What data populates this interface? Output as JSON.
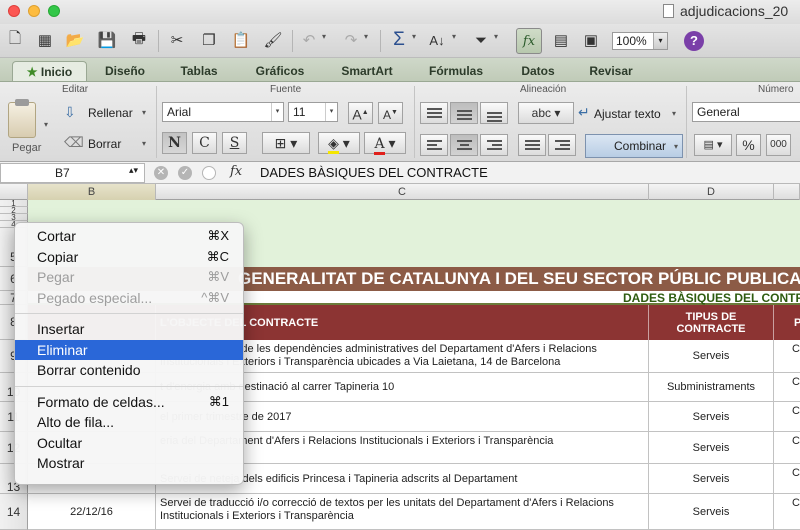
{
  "window": {
    "title": "adjudicacions_20"
  },
  "toolbar": {
    "zoom": "100%"
  },
  "ribbon_tabs": [
    "Inicio",
    "Diseño",
    "Tablas",
    "Gráficos",
    "SmartArt",
    "Fórmulas",
    "Datos",
    "Revisar"
  ],
  "ribbon": {
    "editar": {
      "title": "Editar",
      "pegar": "Pegar",
      "rellenar": "Rellenar",
      "borrar": "Borrar"
    },
    "fuente": {
      "title": "Fuente",
      "font_name": "Arial",
      "font_size": "11",
      "grow": "A",
      "shrink": "A",
      "bold": "N",
      "italic": "C",
      "underline": "S",
      "font_color": "A"
    },
    "alineacion": {
      "title": "Alineación",
      "abc": "abc",
      "ajustar_texto": "Ajustar texto",
      "combinar": "Combinar"
    },
    "numero": {
      "title": "Número",
      "format": "General",
      "percent": "%",
      "thousands": "000"
    }
  },
  "formula_bar": {
    "cell_ref": "B7",
    "fx": "fx",
    "content": "DADES BÀSIQUES DEL CONTRACTE"
  },
  "columns": [
    "B",
    "C",
    "D"
  ],
  "rows": [
    "1",
    "2",
    "3",
    "4",
    "5",
    "6",
    "7",
    "8",
    "9",
    "10",
    "11",
    "12",
    "13",
    "14"
  ],
  "sheet": {
    "banner": "GENERALITAT DE CATALUNYA I DEL SEU SECTOR PÚBLIC PUBLICADES",
    "subbanner": "DADES BÀSIQUES DEL CONTR",
    "header_c": "L'OBJECTE DEL CONTRACTE",
    "header_d": "TIPUS DE CONTRACTE",
    "header_e": "P",
    "table_rows": [
      {
        "date": "",
        "object": "eteja i seguretat de les dependències administratives del Departament d'Afers i Relacions Institucionals i Exteriors i Transparència ubicades a Via Laietana, 14 de Barcelona",
        "type": "Serveis",
        "extra": "Co"
      },
      {
        "date": "",
        "object": "t d'energia amb destinació al carrer Tapineria 10",
        "type": "Subministraments",
        "extra": "Co"
      },
      {
        "date": "",
        "object": "el primer trimestre de 2017",
        "type": "Serveis",
        "extra": "Co"
      },
      {
        "date": "",
        "object": "eria del Departament d'Afers i Relacions Institucionals i Exteriors i Transparència",
        "type": "Serveis",
        "extra": "Co"
      },
      {
        "date": "",
        "object": "Servei de neteja dels edificis Princesa i Tapineria adscrits al Departament",
        "type": "Serveis",
        "extra": "Co"
      },
      {
        "date": "22/12/16",
        "object": "Servei de traducció i/o correcció de textos per les unitats del Departament d'Afers i Relacions Institucionals i Exteriors i Transparència",
        "type": "Serveis",
        "extra": "Co"
      }
    ]
  },
  "context_menu": {
    "items": [
      {
        "label": "Cortar",
        "shortcut": "⌘X",
        "enabled": true
      },
      {
        "label": "Copiar",
        "shortcut": "⌘C",
        "enabled": true
      },
      {
        "label": "Pegar",
        "shortcut": "⌘V",
        "enabled": false
      },
      {
        "label": "Pegado especial...",
        "shortcut": "^⌘V",
        "enabled": false
      },
      {
        "label": "Insertar",
        "shortcut": "",
        "enabled": true
      },
      {
        "label": "Eliminar",
        "shortcut": "",
        "enabled": true,
        "highlighted": true
      },
      {
        "label": "Borrar contenido",
        "shortcut": "",
        "enabled": true
      },
      {
        "label": "Formato de celdas...",
        "shortcut": "⌘1",
        "enabled": true
      },
      {
        "label": "Alto de fila...",
        "shortcut": "",
        "enabled": true
      },
      {
        "label": "Ocultar",
        "shortcut": "",
        "enabled": true
      },
      {
        "label": "Mostrar",
        "shortcut": "",
        "enabled": true
      }
    ]
  },
  "colors": {
    "banner": "#8c5b46",
    "table_header": "#8c3433",
    "sheet_green": "#e2f2da",
    "menu_highlight": "#2a67d8"
  }
}
